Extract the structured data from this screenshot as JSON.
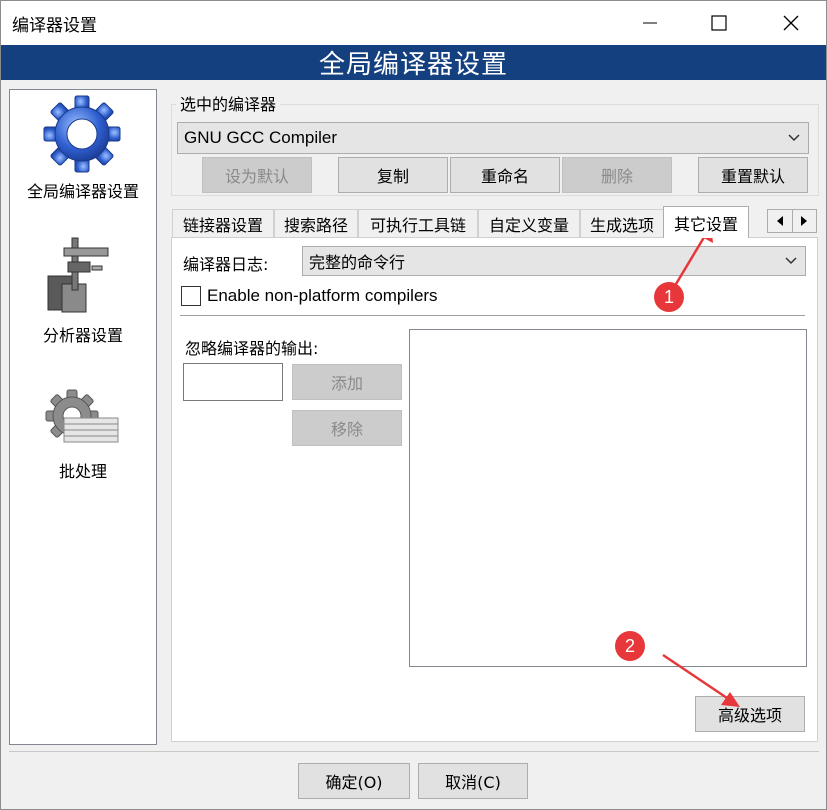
{
  "window": {
    "title": "编译器设置",
    "header": "全局编译器设置"
  },
  "sidebar": {
    "items": [
      {
        "label": "全局编译器设置",
        "icon": "gear-icon",
        "selected": true
      },
      {
        "label": "分析器设置",
        "icon": "profiler-icon"
      },
      {
        "label": "批处理",
        "icon": "batch-gear-icon"
      }
    ]
  },
  "compiler_group": {
    "legend": "选中的编译器",
    "selected": "GNU GCC Compiler",
    "buttons": {
      "set_default": "设为默认",
      "copy": "复制",
      "rename": "重命名",
      "delete": "删除",
      "reset_defaults": "重置默认"
    }
  },
  "tabs": [
    {
      "label": "链接器设置"
    },
    {
      "label": "搜索路径"
    },
    {
      "label": "可执行工具链"
    },
    {
      "label": "自定义变量"
    },
    {
      "label": "生成选项"
    },
    {
      "label": "其它设置",
      "active": true
    }
  ],
  "other_settings": {
    "log_label": "编译器日志:",
    "log_value": "完整的命令行",
    "enable_nonplatform": "Enable non-platform compilers",
    "ignore_output_label": "忽略编译器的输出:",
    "add_button": "添加",
    "remove_button": "移除",
    "advanced_button": "高级选项"
  },
  "footer": {
    "ok": "确定(O)",
    "cancel": "取消(C)"
  },
  "annotations": {
    "badge1": "1",
    "badge2": "2",
    "color": "#e8373a"
  }
}
